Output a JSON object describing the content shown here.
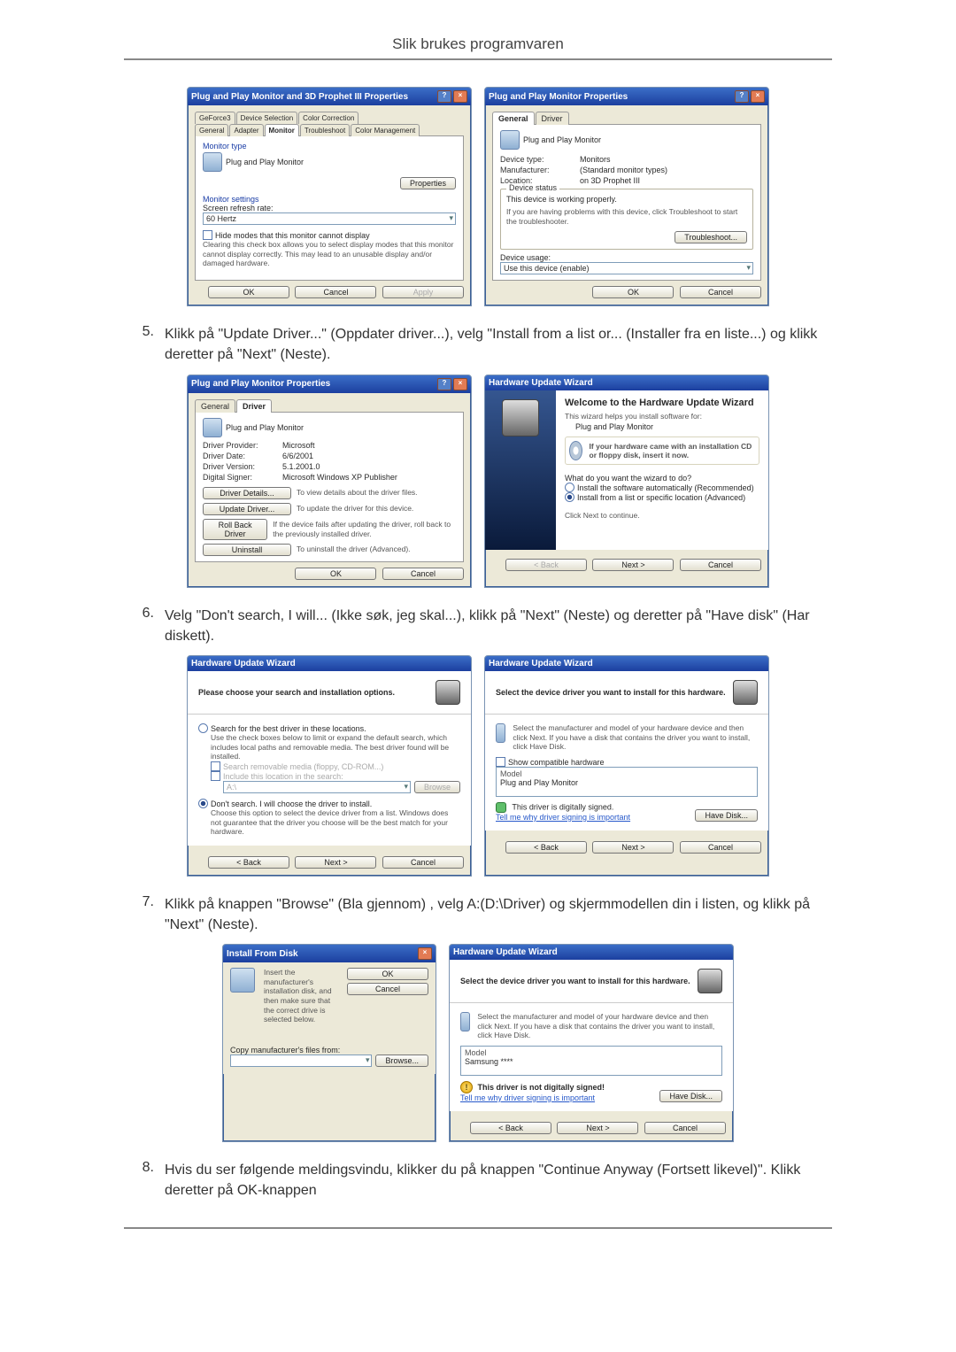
{
  "page_title": "Slik brukes programvaren",
  "steps": {
    "s5": {
      "num": "5.",
      "text": "Klikk på \"Update Driver...\" (Oppdater driver...), velg \"Install from a list or... (Installer fra en liste...) og klikk deretter på \"Next\" (Neste)."
    },
    "s6": {
      "num": "6.",
      "text": "Velg \"Don't search, I will... (Ikke søk, jeg skal...), klikk på \"Next\" (Neste) og deretter på \"Have disk\" (Har diskett)."
    },
    "s7": {
      "num": "7.",
      "text": "Klikk på knappen \"Browse\" (Bla gjennom) , velg A:(D:\\Driver) og skjermmodellen din i listen, og klikk på \"Next\" (Neste)."
    },
    "s8": {
      "num": "8.",
      "text": "Hvis du ser følgende meldingsvindu, klikker du på knappen \"Continue Anyway (Fortsett likevel)\". Klikk deretter på OK-knappen"
    }
  },
  "dlgA": {
    "title": "Plug and Play Monitor and 3D Prophet III Properties",
    "tabs_top": [
      "GeForce3",
      "Device Selection",
      "Color Correction"
    ],
    "tabs_bot": [
      "General",
      "Adapter",
      "Monitor",
      "Troubleshoot",
      "Color Management"
    ],
    "mon_type_label": "Monitor type",
    "mon_type_value": "Plug and Play Monitor",
    "properties_btn": "Properties",
    "mon_settings_label": "Monitor settings",
    "refresh_label": "Screen refresh rate:",
    "refresh_value": "60 Hertz",
    "hide_check": "Hide modes that this monitor cannot display",
    "hide_hint": "Clearing this check box allows you to select display modes that this monitor cannot display correctly. This may lead to an unusable display and/or damaged hardware.",
    "ok": "OK",
    "cancel": "Cancel",
    "apply": "Apply"
  },
  "dlgB": {
    "title": "Plug and Play Monitor Properties",
    "tabs": [
      "General",
      "Driver"
    ],
    "heading": "Plug and Play Monitor",
    "kv": {
      "device_type_k": "Device type:",
      "device_type_v": "Monitors",
      "manufacturer_k": "Manufacturer:",
      "manufacturer_v": "(Standard monitor types)",
      "location_k": "Location:",
      "location_v": "on 3D Prophet III"
    },
    "status_legend": "Device status",
    "status_working": "This device is working properly.",
    "status_hint": "If you are having problems with this device, click Troubleshoot to start the troubleshooter.",
    "troubleshoot_btn": "Troubleshoot...",
    "usage_label": "Device usage:",
    "usage_value": "Use this device (enable)",
    "ok": "OK",
    "cancel": "Cancel"
  },
  "dlgC": {
    "title": "Plug and Play Monitor Properties",
    "tabs": [
      "General",
      "Driver"
    ],
    "heading": "Plug and Play Monitor",
    "kv": {
      "provider_k": "Driver Provider:",
      "provider_v": "Microsoft",
      "date_k": "Driver Date:",
      "date_v": "6/6/2001",
      "ver_k": "Driver Version:",
      "ver_v": "5.1.2001.0",
      "signer_k": "Digital Signer:",
      "signer_v": "Microsoft Windows XP Publisher"
    },
    "btn_details": "Driver Details...",
    "btn_details_hint": "To view details about the driver files.",
    "btn_update": "Update Driver...",
    "btn_update_hint": "To update the driver for this device.",
    "btn_rollback": "Roll Back Driver",
    "btn_rollback_hint": "If the device fails after updating the driver, roll back to the previously installed driver.",
    "btn_uninstall": "Uninstall",
    "btn_uninstall_hint": "To uninstall the driver (Advanced).",
    "ok": "OK",
    "cancel": "Cancel"
  },
  "dlgD": {
    "title": "Hardware Update Wizard",
    "big_title": "Welcome to the Hardware Update Wizard",
    "line1": "This wizard helps you install software for:",
    "line2": "Plug and Play Monitor",
    "cd_hint": "If your hardware came with an installation CD or floppy disk, insert it now.",
    "q": "What do you want the wizard to do?",
    "opt1": "Install the software automatically (Recommended)",
    "opt2": "Install from a list or specific location (Advanced)",
    "cont": "Click Next to continue.",
    "back": "< Back",
    "next": "Next >",
    "cancel": "Cancel"
  },
  "dlgE": {
    "title": "Hardware Update Wizard",
    "prompt": "Please choose your search and installation options.",
    "opt1": "Search for the best driver in these locations.",
    "opt1_hint": "Use the check boxes below to limit or expand the default search, which includes local paths and removable media. The best driver found will be installed.",
    "chk1": "Search removable media (floppy, CD-ROM...)",
    "chk2": "Include this location in the search:",
    "loc": "A:\\",
    "browse": "Browse",
    "opt2": "Don't search. I will choose the driver to install.",
    "opt2_hint": "Choose this option to select the device driver from a list. Windows does not guarantee that the driver you choose will be the best match for your hardware.",
    "back": "< Back",
    "next": "Next >",
    "cancel": "Cancel"
  },
  "dlgF": {
    "title": "Hardware Update Wizard",
    "prompt": "Select the device driver you want to install for this hardware.",
    "hint": "Select the manufacturer and model of your hardware device and then click Next. If you have a disk that contains the driver you want to install, click Have Disk.",
    "show_compatible": "Show compatible hardware",
    "model_label": "Model",
    "model_value": "Plug and Play Monitor",
    "signed": "This driver is digitally signed.",
    "tell_me": "Tell me why driver signing is important",
    "have_disk": "Have Disk...",
    "back": "< Back",
    "next": "Next >",
    "cancel": "Cancel"
  },
  "dlgG": {
    "title": "Install From Disk",
    "line": "Insert the manufacturer's installation disk, and then make sure that the correct drive is selected below.",
    "ok": "OK",
    "cancel": "Cancel",
    "copy_label": "Copy manufacturer's files from:",
    "path": "",
    "browse": "Browse..."
  },
  "dlgH": {
    "title": "Hardware Update Wizard",
    "prompt": "Select the device driver you want to install for this hardware.",
    "hint": "Select the manufacturer and model of your hardware device and then click Next. If you have a disk that contains the driver you want to install, click Have Disk.",
    "model_label": "Model",
    "model_value": "Samsung ****",
    "not_signed": "This driver is not digitally signed!",
    "tell_me": "Tell me why driver signing is important",
    "have_disk": "Have Disk...",
    "back": "< Back",
    "next": "Next >",
    "cancel": "Cancel"
  }
}
